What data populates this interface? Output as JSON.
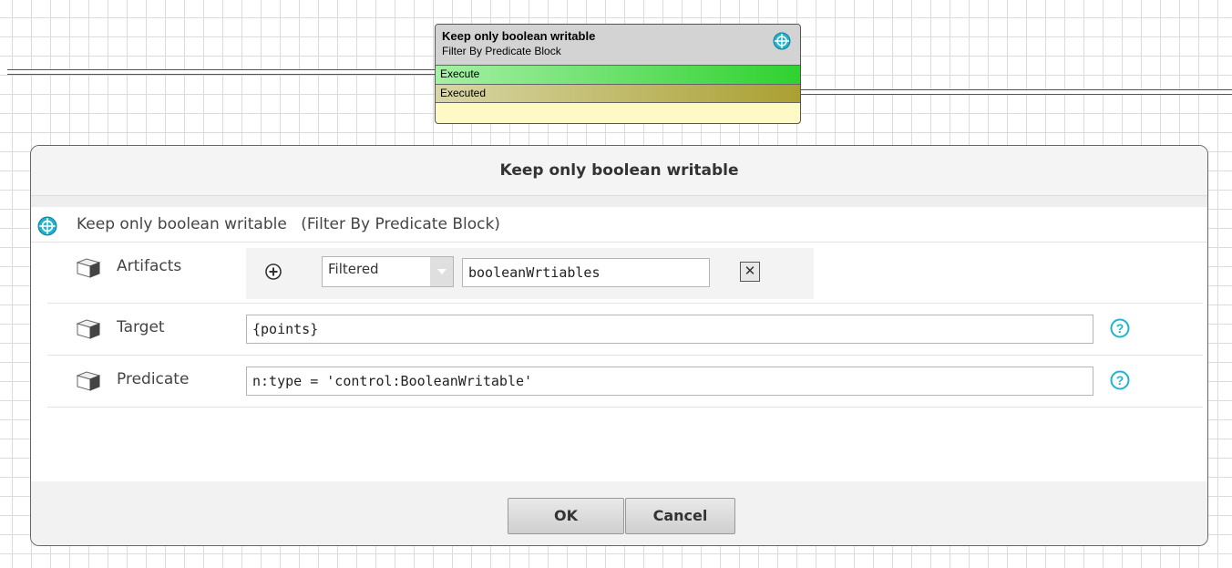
{
  "canvas_block": {
    "title": "Keep only boolean writable",
    "subtitle": "Filter By Predicate Block",
    "slots": [
      "Execute",
      "Executed"
    ],
    "icon": "target-icon"
  },
  "dialog": {
    "title": "Keep only boolean writable",
    "block_name": "Keep only boolean writable",
    "block_type": "(Filter By Predicate Block)",
    "artifacts": {
      "label": "Artifacts",
      "mode": "Filtered",
      "value": "booleanWrtiables"
    },
    "target": {
      "label": "Target",
      "value": "{points}"
    },
    "predicate": {
      "label": "Predicate",
      "value": "n:type = 'control:BooleanWritable'"
    },
    "buttons": {
      "ok": "OK",
      "cancel": "Cancel"
    }
  },
  "colors": {
    "accent": "#1fb3d0",
    "execute_slot": "#2fd12f",
    "executed_slot": "#aaa032"
  }
}
